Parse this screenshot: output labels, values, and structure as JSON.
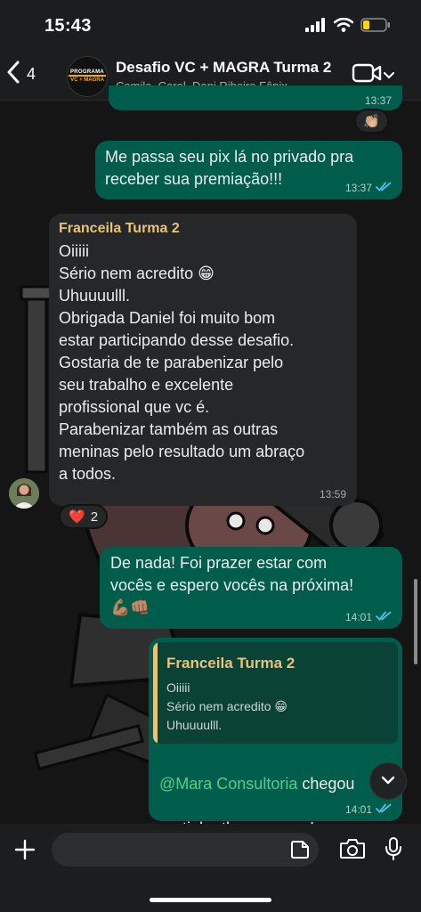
{
  "status_bar": {
    "time": "15:43",
    "battery_color": "#ffd60a"
  },
  "header": {
    "back_count": "4",
    "avatar_line1": "PROGRAMA",
    "avatar_line2": "VC + MAGRA",
    "title": "Desafio VC + MAGRA Turma 2",
    "members": "Camila, Carol, Dani Ribeiro Fênix,..."
  },
  "messages": {
    "partial_top": {
      "time": "13:37"
    },
    "clap_reaction": {
      "emoji": "👏🏼"
    },
    "msg1": {
      "text": "Me passa seu pix lá no privado pra\nreceber sua premiação!!!",
      "time": "13:37"
    },
    "msg2": {
      "sender": "Franceila Turma 2",
      "text": "Oiiiii\nSério nem acredito 😁\nUhuuuulll.\nObrigada Daniel foi muito bom\nestar participando desse desafio.\nGostaria de te parabenizar pelo\nseu trabalho e excelente\nprofissional que vc é.\nParabenizar também as outras\nmeninas pelo resultado  um abraço\na todos.",
      "time": "13:59",
      "reaction_emoji": "❤️",
      "reaction_count": "2"
    },
    "msg3": {
      "text": "De nada! Foi prazer estar com\nvocês e espero vocês na próxima!\n💪🏽👊🏽",
      "time": "14:01"
    },
    "msg4": {
      "quote_sender": "Franceila Turma 2",
      "quote_text": "Oiiiii\nSério nem acredito 😁\nUhuuuulll.",
      "mention": "@Mara Consultoria",
      "text_after_mention": " chegou",
      "text_line2": "pertinho tbem, quase!",
      "time": "14:01"
    }
  },
  "colors": {
    "outgoing_bubble": "#005c4b",
    "incoming_bubble": "#262729",
    "sender_name": "#e8c37a",
    "read_ticks": "#53bdeb",
    "mention": "#4fd18b"
  }
}
